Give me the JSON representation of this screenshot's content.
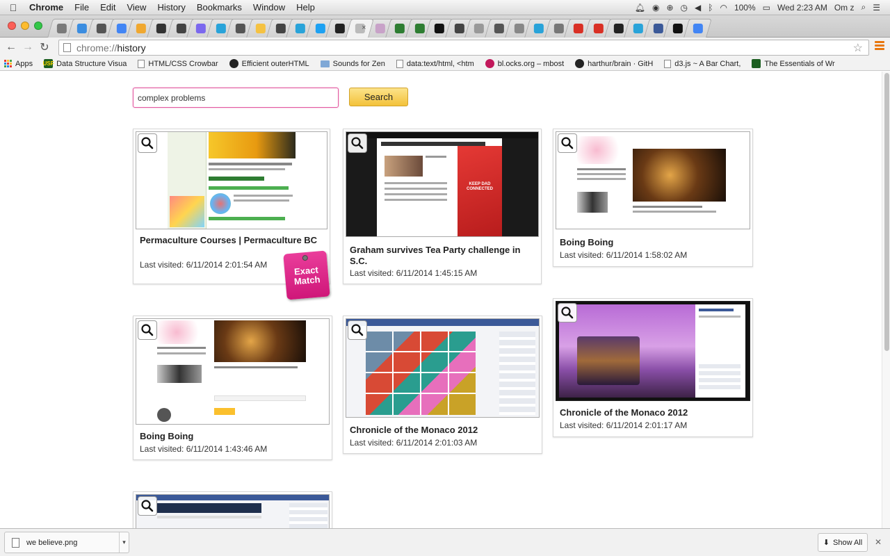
{
  "menubar": {
    "app": "Chrome",
    "menus": [
      "File",
      "Edit",
      "View",
      "History",
      "Bookmarks",
      "Window",
      "Help"
    ],
    "battery": "100%",
    "clock": "Wed 2:23 AM",
    "user": "Om z"
  },
  "tabs": {
    "active_close": "×",
    "favicon_colors": [
      "#7a7a7a",
      "#3b8de0",
      "#555",
      "#4285f4",
      "#f0a830",
      "#333",
      "#444",
      "#7b68ee",
      "#29a3d9",
      "#555",
      "#f5c242",
      "#444",
      "#29a3d9",
      "#1da1f2",
      "#222",
      "#bbb",
      "#c8a2c8",
      "#2e7d32",
      "#2e7d32",
      "#111",
      "#444",
      "#999",
      "#555",
      "#888",
      "#29a3d9",
      "#777",
      "#d93025",
      "#d93025",
      "#222",
      "#29a3d9",
      "#3b5998",
      "#111",
      "#4285f4"
    ]
  },
  "toolbar": {
    "url_scheme": "chrome://",
    "url_host": "history",
    "star_glyph": "☆"
  },
  "bookmarks": [
    {
      "label": "Apps",
      "icon": "apps-grid"
    },
    {
      "label": "Data Structure Visua",
      "icon": "usf-logo"
    },
    {
      "label": "HTML/CSS Crowbar",
      "icon": "page"
    },
    {
      "label": "Efficient outerHTML",
      "icon": "github"
    },
    {
      "label": "Sounds for Zen",
      "icon": "folder"
    },
    {
      "label": "data:text/html, <htm",
      "icon": "page"
    },
    {
      "label": "bl.ocks.org – mbost",
      "icon": "blocks"
    },
    {
      "label": "harthur/brain · GitH",
      "icon": "github"
    },
    {
      "label": "d3.js ~ A Bar Chart,",
      "icon": "page"
    },
    {
      "label": "The Essentials of Wr",
      "icon": "green-book"
    }
  ],
  "search": {
    "value": "complex problems",
    "button": "Search"
  },
  "results": [
    {
      "title": "Permaculture Courses | Permaculture BC",
      "date": "Last visited: 6/11/2014 2:01:54 AM"
    },
    {
      "title": "Graham survives Tea Party challenge in S.C.",
      "date": "Last visited: 6/11/2014 1:45:15 AM"
    },
    {
      "title": "Boing Boing",
      "date": "Last visited: 6/11/2014 1:58:02 AM"
    },
    {
      "title": "Boing Boing",
      "date": "Last visited: 6/11/2014 1:43:46 AM"
    },
    {
      "title": "Chronicle of the Monaco 2012",
      "date": "Last visited: 6/11/2014 2:01:03 AM"
    },
    {
      "title": "Chronicle of the Monaco 2012",
      "date": "Last visited: 6/11/2014 2:01:17 AM"
    }
  ],
  "badge": {
    "line1": "Exact",
    "line2": "Match"
  },
  "downloads": {
    "file": "we believe.png",
    "show_all": "Show All"
  }
}
